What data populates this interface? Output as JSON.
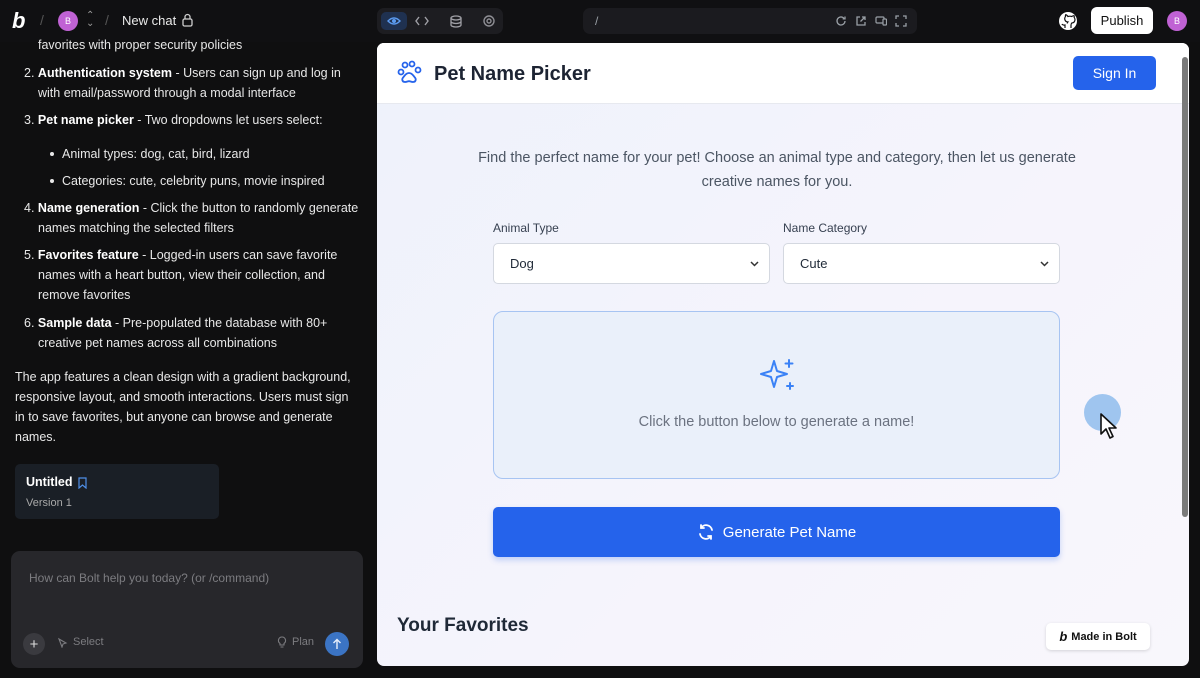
{
  "topbar": {
    "avatar_initial": "B",
    "chat_title": "New chat",
    "url": "/",
    "publish_label": "Publish",
    "user_initial": "B"
  },
  "chat": {
    "partial_line": "favorites with proper security policies",
    "items": [
      {
        "num": "2.",
        "title": "Authentication system",
        "text1": " - Users can sign up and log in",
        "text2": "with email/password through a modal interface"
      },
      {
        "num": "3.",
        "title": "Pet name picker",
        "text1": " - Two dropdowns let users select:"
      },
      {
        "num": "4.",
        "title": "Name generation",
        "text1": " - Click the button to randomly generate",
        "text2": "names matching the selected filters"
      },
      {
        "num": "5.",
        "title": "Favorites feature",
        "text1": " - Logged-in users can save favorite",
        "text2": "names with a heart button, view their collection, and",
        "text3": "remove favorites"
      },
      {
        "num": "6.",
        "title": "Sample data",
        "text1": " - Pre-populated the database with 80+",
        "text2": "creative pet names across all combinations"
      }
    ],
    "bullets": [
      "Animal types: dog, cat, bird, lizard",
      "Categories: cute, celebrity puns, movie inspired"
    ],
    "summary": [
      "The app features a clean design with a gradient background,",
      "responsive layout, and smooth interactions. Users must sign",
      "in to save favorites, but anyone can browse and generate",
      "names."
    ],
    "version_card": {
      "title": "Untitled",
      "version": "Version 1"
    },
    "prompt": {
      "placeholder": "How can Bolt help you today? (or /command)",
      "select_label": "Select",
      "plan_label": "Plan"
    }
  },
  "preview": {
    "app_title": "Pet Name Picker",
    "signin_label": "Sign In",
    "intro": "Find the perfect name for your pet! Choose an animal type and category, then let us generate creative names for you.",
    "animal_label": "Animal Type",
    "animal_value": "Dog",
    "category_label": "Name Category",
    "category_value": "Cute",
    "placeholder_text": "Click the button below to generate a name!",
    "generate_label": "Generate Pet Name",
    "favorites_title": "Your Favorites",
    "made_in": "Made in Bolt"
  },
  "colors": {
    "accent": "#2563eb",
    "avatar": "#c062d4"
  }
}
